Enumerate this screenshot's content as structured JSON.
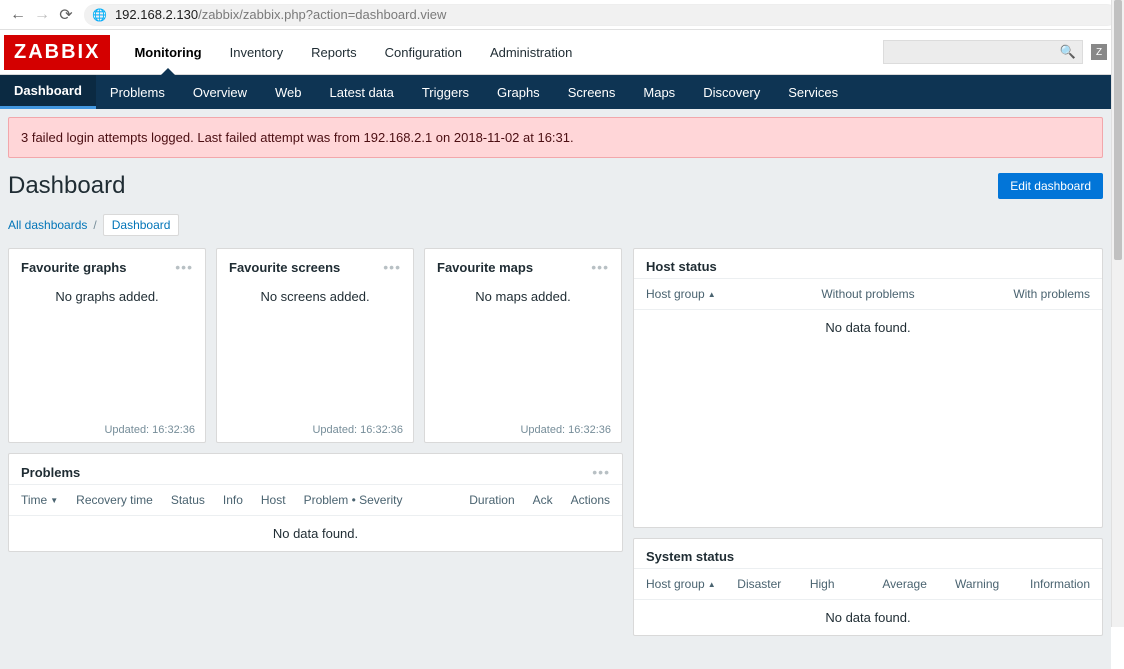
{
  "browser": {
    "url_host": "192.168.2.130",
    "url_path": "/zabbix/zabbix.php?action=dashboard.view"
  },
  "logo": "ZABBIX",
  "top_nav": [
    {
      "label": "Monitoring",
      "active": true
    },
    {
      "label": "Inventory"
    },
    {
      "label": "Reports"
    },
    {
      "label": "Configuration"
    },
    {
      "label": "Administration"
    }
  ],
  "z_badge": "Z",
  "sub_nav": [
    {
      "label": "Dashboard",
      "active": true
    },
    {
      "label": "Problems"
    },
    {
      "label": "Overview"
    },
    {
      "label": "Web"
    },
    {
      "label": "Latest data"
    },
    {
      "label": "Triggers"
    },
    {
      "label": "Graphs"
    },
    {
      "label": "Screens"
    },
    {
      "label": "Maps"
    },
    {
      "label": "Discovery"
    },
    {
      "label": "Services"
    }
  ],
  "alert": {
    "text": "3 failed login attempts logged. Last failed attempt was from 192.168.2.1 on 2018-11-02 at 16:31."
  },
  "page_title": "Dashboard",
  "edit_label": "Edit dashboard",
  "breadcrumb": {
    "all": "All dashboards",
    "sep": "/",
    "current": "Dashboard"
  },
  "favourites": [
    {
      "title": "Favourite graphs",
      "empty": "No graphs added.",
      "updated": "Updated: 16:32:36"
    },
    {
      "title": "Favourite screens",
      "empty": "No screens added.",
      "updated": "Updated: 16:32:36"
    },
    {
      "title": "Favourite maps",
      "empty": "No maps added.",
      "updated": "Updated: 16:32:36"
    }
  ],
  "problems": {
    "title": "Problems",
    "columns": [
      "Time",
      "Recovery time",
      "Status",
      "Info",
      "Host",
      "Problem • Severity",
      "Duration",
      "Ack",
      "Actions"
    ],
    "empty": "No data found."
  },
  "host_status": {
    "title": "Host status",
    "columns": [
      "Host group",
      "Without problems",
      "With problems"
    ],
    "empty": "No data found."
  },
  "system_status": {
    "title": "System status",
    "columns": [
      "Host group",
      "Disaster",
      "High",
      "Average",
      "Warning",
      "Information"
    ],
    "empty": "No data found."
  }
}
